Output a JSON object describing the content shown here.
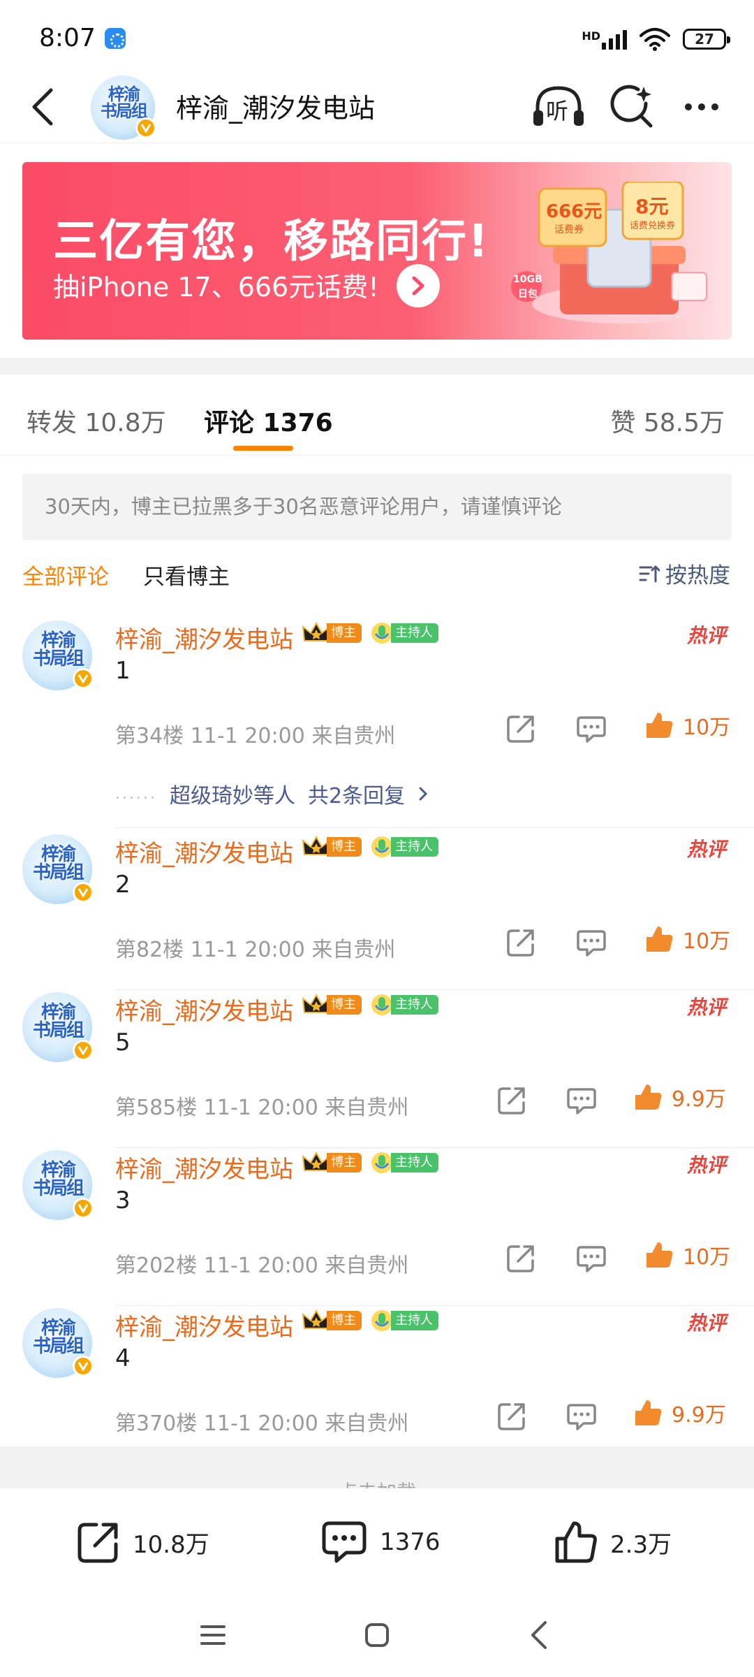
{
  "status_bar": {
    "time": "8:07",
    "network_label": "HD",
    "battery": "27"
  },
  "header": {
    "title": "梓渝_潮汐发电站",
    "avatar_text_line1": "梓渝",
    "avatar_text_line2": "书局组",
    "listen_label": "听"
  },
  "banner": {
    "title": "三亿有您，移路同行!",
    "subtitle": "抽iPhone 17、666元话费!",
    "gift_text_1": "666元",
    "gift_text_2": "话费券",
    "gift_text_3": "8元",
    "gift_text_4": "话费兑换券",
    "gift_text_5": "10GB",
    "gift_text_6": "日包"
  },
  "tabs": {
    "repost": "转发 10.8万",
    "comment": "评论 1376",
    "like": "赞 58.5万"
  },
  "notice": "30天内，博主已拉黑多于30名恶意评论用户，请谨慎评论",
  "filter": {
    "all": "全部评论",
    "author_only": "只看博主",
    "sort": "按热度"
  },
  "badges": {
    "blogger": "博主",
    "host": "主持人",
    "hot": "热评"
  },
  "comments": [
    {
      "name": "梓渝_潮汐发电站",
      "text": "1",
      "meta": "第34楼  11-1 20:00  来自贵州",
      "likes": "10万",
      "reply_summary": "超级琦妙等人",
      "reply_count": "共2条回复",
      "reply_dots": "......"
    },
    {
      "name": "梓渝_潮汐发电站",
      "text": "2",
      "meta": "第82楼  11-1 20:00  来自贵州",
      "likes": "10万"
    },
    {
      "name": "梓渝_潮汐发电站",
      "text": "5",
      "meta": "第585楼  11-1 20:00  来自贵州",
      "likes": "9.9万"
    },
    {
      "name": "梓渝_潮汐发电站",
      "text": "3",
      "meta": "第202楼  11-1 20:00  来自贵州",
      "likes": "10万"
    },
    {
      "name": "梓渝_潮汐发电站",
      "text": "4",
      "meta": "第370楼  11-1 20:00  来自贵州",
      "likes": "9.9万"
    }
  ],
  "load_more": "点击加载",
  "bottom_bar": {
    "repost_count": "10.8万",
    "comment_count": "1376",
    "like_count": "2.3万"
  },
  "colors": {
    "accent_orange": "#ff8200",
    "name_orange": "#e86c1f",
    "hot_red": "#e8453c",
    "banner_red": "#fb4b66"
  }
}
